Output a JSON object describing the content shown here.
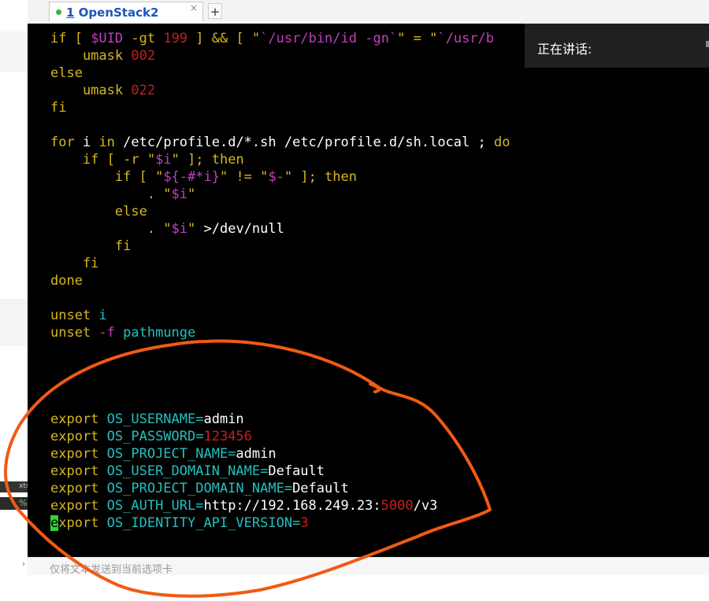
{
  "tab": {
    "number": "1",
    "title": " OpenStack2",
    "close_glyph": "×",
    "add_glyph": "+"
  },
  "notice": {
    "text": "正在讲话:"
  },
  "status": {
    "placeholder": "仅将文本发送到当前选项卡"
  },
  "left_strip": {
    "label_xts": "xts",
    "label_pct": "%"
  },
  "terminal": {
    "l1": {
      "a": "if [ ",
      "b": "$UID",
      "c": " -gt ",
      "d": "199",
      "e": " ] && [ \"",
      "f": "`/usr/bin/id -gn`",
      "g": "\" = \"",
      "h": "`/usr/b"
    },
    "l2": {
      "a": "    umask ",
      "b": "002"
    },
    "l3": {
      "a": "else"
    },
    "l4": {
      "a": "    umask ",
      "b": "022"
    },
    "l5": {
      "a": "fi"
    },
    "l6": {
      "a": "for",
      "b": " i ",
      "c": "in",
      "d": " /etc/profile.d/*.sh /etc/profile.d/sh.local ; ",
      "e": "do"
    },
    "l7": {
      "a": "    if",
      "b": " [ -r \"",
      "c": "$i",
      "d": "\" ]; ",
      "e": "then"
    },
    "l8": {
      "a": "        if",
      "b": " [ \"",
      "c": "${-#*i}",
      "d": "\" != \"",
      "e": "$-",
      "f": "\" ]; ",
      "g": "then"
    },
    "l9": {
      "a": "            . \"",
      "b": "$i",
      "c": "\""
    },
    "l10": {
      "a": "        else"
    },
    "l11": {
      "a": "            . \"",
      "b": "$i",
      "c": "\" ",
      "d": ">/dev/null"
    },
    "l12": {
      "a": "        fi"
    },
    "l13": {
      "a": "    fi"
    },
    "l14": {
      "a": "done"
    },
    "l15": {
      "a": "unset",
      "b": " i"
    },
    "l16": {
      "a": "unset",
      "b": " -f",
      "c": " pathmunge"
    },
    "l17": {
      "a": "export",
      "b": " OS_USERNAME=",
      "c": "admin"
    },
    "l18": {
      "a": "export",
      "b": " OS_PASSWORD=",
      "c": "123456"
    },
    "l19": {
      "a": "export",
      "b": " OS_PROJECT_NAME=",
      "c": "admin"
    },
    "l20": {
      "a": "export",
      "b": " OS_USER_DOMAIN_NAME=",
      "c": "Default"
    },
    "l21": {
      "a": "export",
      "b": " OS_PROJECT_DOMAIN_NAME=",
      "c": "Default"
    },
    "l22": {
      "a": "export",
      "b": " OS_AUTH_URL=",
      "c": "http://192.168.249.23:",
      "d": "5000",
      "e": "/v3"
    },
    "l23": {
      "cursor": "e",
      "a": "xport",
      "b": " OS_IDENTITY_API_VERSION=",
      "c": "3"
    }
  },
  "colors": {
    "terminal_bg": "#000000",
    "keyword": "#d6b71e",
    "number": "#c81e1e",
    "variable": "#c23fc2",
    "identifier": "#22c0c0",
    "cursor": "#2fd62f",
    "annotation": "#f25a12"
  }
}
